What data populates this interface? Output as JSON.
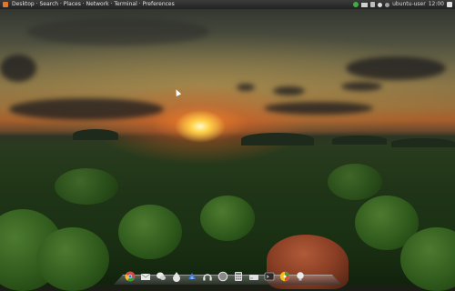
{
  "top_panel": {
    "window_title": "Desktop · Search · Places · Network · Terminal · Preferences",
    "tray": {
      "network_label": "Network",
      "volume_label": "Vol",
      "user_label": "ubuntu-user",
      "clock": "12:00"
    }
  },
  "dock": {
    "items": [
      {
        "name": "chrome-icon",
        "label": "Chrome"
      },
      {
        "name": "mail-icon",
        "label": "Mail"
      },
      {
        "name": "chat-icon",
        "label": "Chat"
      },
      {
        "name": "droplet-icon",
        "label": "Water"
      },
      {
        "name": "music-icon",
        "label": "Music"
      },
      {
        "name": "headphones-icon",
        "label": "Audio"
      },
      {
        "name": "safari-icon",
        "label": "Browser"
      },
      {
        "name": "calculator-icon",
        "label": "Calculator"
      },
      {
        "name": "drive-icon",
        "label": "Drive"
      },
      {
        "name": "terminal-icon",
        "label": "Terminal"
      },
      {
        "name": "monitor-icon",
        "label": "Monitor"
      },
      {
        "name": "bulb-icon",
        "label": "Ideas"
      }
    ]
  },
  "colors": {
    "panel_bg": "#2a2a2a",
    "sun": "#ffd24a",
    "sky_glow": "#a85f2c",
    "forest": "#1f3416"
  }
}
